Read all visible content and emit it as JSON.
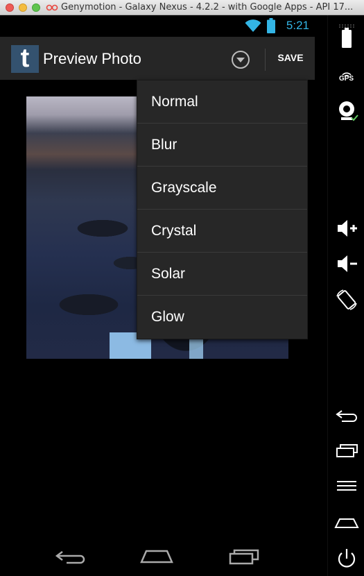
{
  "window": {
    "title": "Genymotion - Galaxy Nexus - 4.2.2 - with Google Apps - API 17..."
  },
  "statusbar": {
    "time": "5:21"
  },
  "actionbar": {
    "logo_letter": "t",
    "title": "Preview Photo",
    "save_label": "SAVE"
  },
  "filter_menu": {
    "items": [
      "Normal",
      "Blur",
      "Grayscale",
      "Crystal",
      "Solar",
      "Glow"
    ]
  },
  "sidebar": {
    "gps_label": "GPS"
  },
  "colors": {
    "accent": "#33b5e5",
    "actionbar": "#262626",
    "menu": "#272727",
    "logo_bg": "#34526f"
  }
}
